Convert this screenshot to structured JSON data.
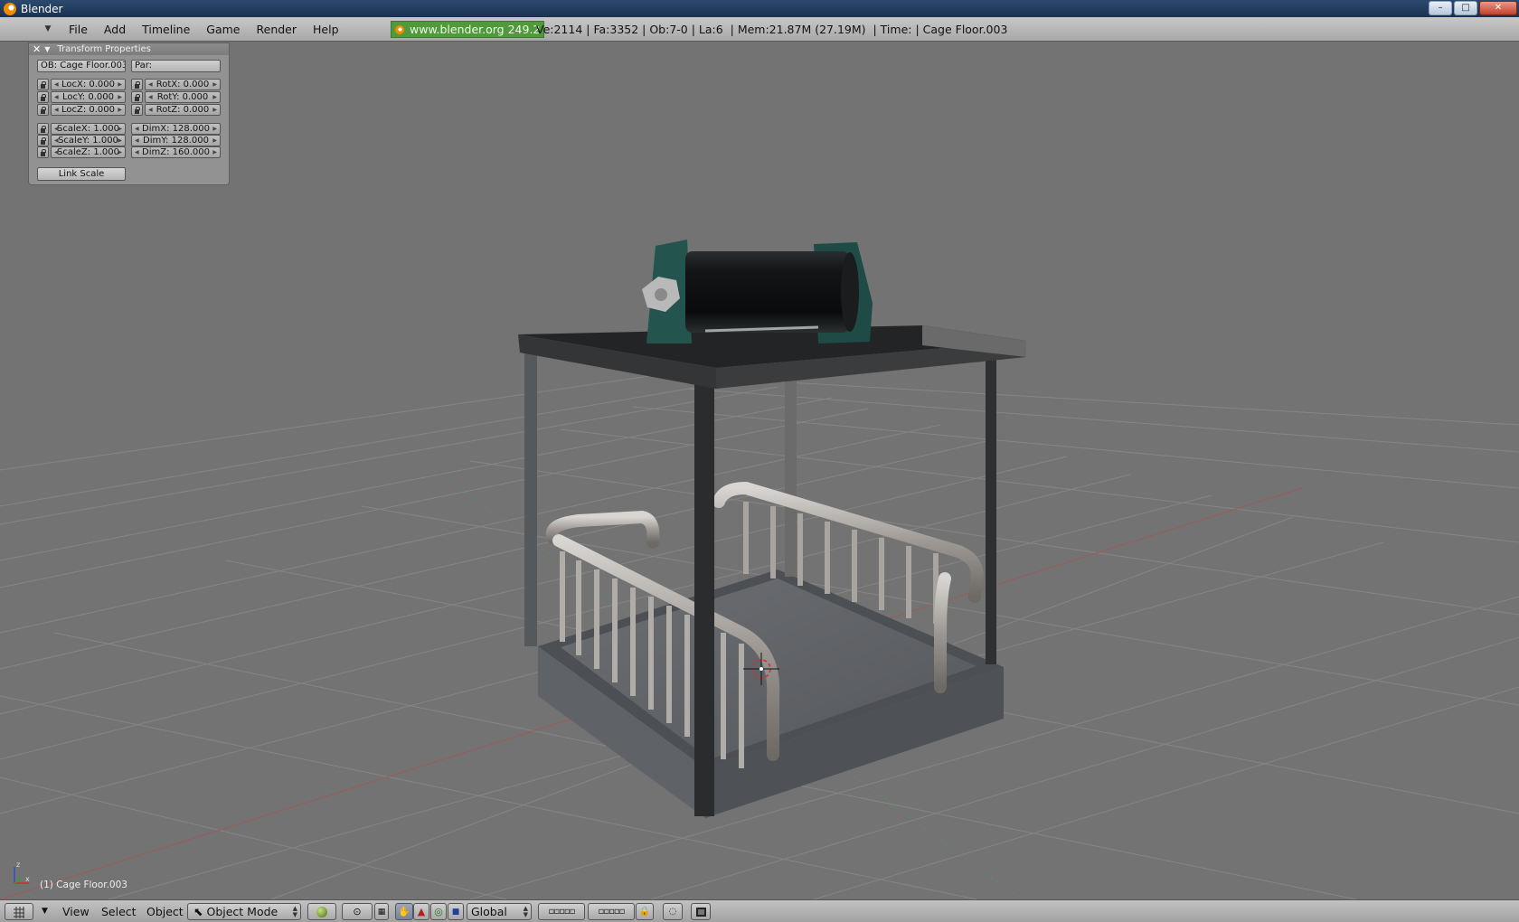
{
  "window": {
    "title": "Blender",
    "controls": {
      "minimize": "–",
      "maximize": "□",
      "close": "✕"
    }
  },
  "top_menu": {
    "items": [
      "File",
      "Add",
      "Timeline",
      "Game",
      "Render",
      "Help"
    ],
    "version_badge": "www.blender.org 249.2",
    "stats": "Ve:2114 | Fa:3352 | Ob:7-0 | La:6  | Mem:21.87M (27.19M)  | Time: | Cage Floor.003"
  },
  "transform_panel": {
    "title": "Transform Properties",
    "object_field": "OB: Cage Floor.003",
    "parent_field": "Par:",
    "loc": [
      "LocX: 0.000",
      "LocY: 0.000",
      "LocZ: 0.000"
    ],
    "rot": [
      "RotX: 0.000",
      "RotY: 0.000",
      "RotZ: 0.000"
    ],
    "scale": [
      "ScaleX: 1.000",
      "ScaleY: 1.000",
      "ScaleZ: 1.000"
    ],
    "dim": [
      "DimX: 128.000",
      "DimY: 128.000",
      "DimZ: 160.000"
    ],
    "link_scale": "Link Scale"
  },
  "viewport": {
    "object_label": "(1) Cage Floor.003",
    "axis_labels": {
      "x": "x",
      "z": "z"
    }
  },
  "bottom_header": {
    "menus": [
      "View",
      "Select",
      "Object"
    ],
    "mode": "Object Mode",
    "orientation": "Global"
  },
  "colors": {
    "viewport_bg": "#737373",
    "header_bg": "#b4b4b4",
    "version_badge": "#4f9a3a",
    "title_bar": "#1f3a5c"
  }
}
